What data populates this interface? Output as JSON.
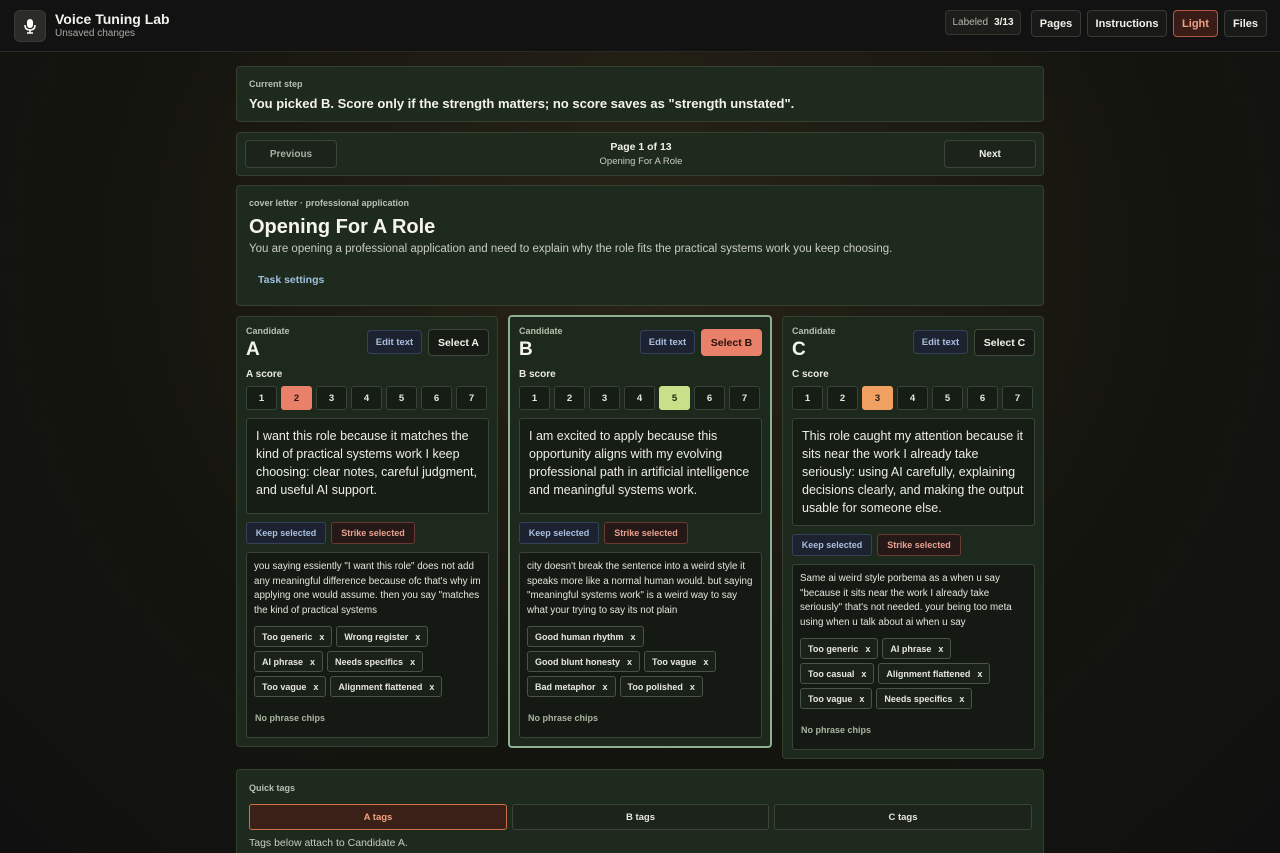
{
  "app": {
    "title": "Voice Tuning Lab",
    "subtitle": "Unsaved changes",
    "logo_icon": "microphone-icon"
  },
  "header": {
    "labeled_label": "Labeled",
    "labeled_count": "3/13",
    "buttons": {
      "pages": "Pages",
      "instructions": "Instructions",
      "light": "Light",
      "files": "Files"
    }
  },
  "current_step": {
    "label": "Current step",
    "text": "You picked B. Score only if the strength matters; no score saves as \"strength unstated\"."
  },
  "pager": {
    "previous": "Previous",
    "next": "Next",
    "page_text": "Page 1 of 13",
    "page_subtitle": "Opening For A Role"
  },
  "task": {
    "meta": "cover letter · professional application",
    "title": "Opening For A Role",
    "description": "You are opening a professional application and need to explain why the role fits the practical systems work you keep choosing.",
    "settings_link": "Task settings"
  },
  "candidates": [
    {
      "label": "Candidate",
      "letter": "A",
      "edit_label": "Edit text",
      "select_label": "Select A",
      "score_label": "A score",
      "scores": [
        "1",
        "2",
        "3",
        "4",
        "5",
        "6",
        "7"
      ],
      "selected_score": 2,
      "text": "I want this role because it matches the kind of practical systems work I keep choosing: clear notes, careful judgment, and useful AI support.",
      "keep_label": "Keep selected",
      "strike_label": "Strike selected",
      "notes": "you saying essiently \"I want this role\" does not add any meaningful difference because ofc that's why im applying one would assume. then you say \"matches the kind of practical systems",
      "chips": [
        "Too generic",
        "Wrong register",
        "AI phrase",
        "Needs specifics",
        "Too vague",
        "Alignment flattened"
      ],
      "no_chips": "No phrase chips"
    },
    {
      "label": "Candidate",
      "letter": "B",
      "edit_label": "Edit text",
      "select_label": "Select B",
      "score_label": "B score",
      "scores": [
        "1",
        "2",
        "3",
        "4",
        "5",
        "6",
        "7"
      ],
      "selected_score": 5,
      "text": "I am excited to apply because this opportunity aligns with my evolving professional path in artificial intelligence and meaningful systems work.",
      "keep_label": "Keep selected",
      "strike_label": "Strike selected",
      "notes": "city doesn't break the sentence into a weird style it speaks more like a normal human would. but saying \"meaningful systems work\" is a weird way to say what your trying to say its not plain",
      "chips": [
        "Good human rhythm",
        "Good blunt honesty",
        "Too vague",
        "Bad metaphor",
        "Too polished"
      ],
      "no_chips": "No phrase chips"
    },
    {
      "label": "Candidate",
      "letter": "C",
      "edit_label": "Edit text",
      "select_label": "Select C",
      "score_label": "C score",
      "scores": [
        "1",
        "2",
        "3",
        "4",
        "5",
        "6",
        "7"
      ],
      "selected_score": 3,
      "text": "This role caught my attention because it sits near the work I already take seriously: using AI carefully, explaining decisions clearly, and making the output usable for someone else.",
      "keep_label": "Keep selected",
      "strike_label": "Strike selected",
      "notes": "Same ai weird style porbema as a when u say \"because it sits near the work I already take seriously\" that's not needed. your being too meta using when u talk about ai when u say",
      "chips": [
        "Too generic",
        "AI phrase",
        "Too casual",
        "Alignment flattened",
        "Too vague",
        "Needs specifics"
      ],
      "no_chips": "No phrase chips"
    }
  ],
  "chip_remove": "x",
  "quick_tags": {
    "label": "Quick tags",
    "tabs": [
      "A tags",
      "B tags",
      "C tags"
    ],
    "active_tab": "A tags",
    "hint": "Tags below attach to Candidate A."
  },
  "colors": {
    "accent_orange": "#e8806a",
    "score_amber": "#f0a060",
    "score_green": "#c8e08a",
    "link_blue": "#9fbfdf"
  }
}
